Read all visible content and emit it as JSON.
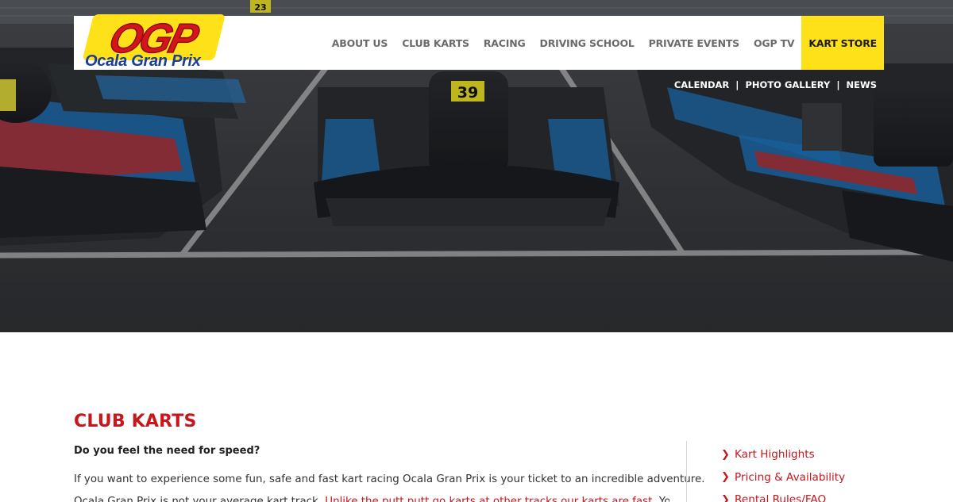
{
  "brand": {
    "logo_mark": "OGP",
    "tagline": "Ocala Gran Prix"
  },
  "nav": {
    "items": [
      {
        "label": "ABOUT US"
      },
      {
        "label": "CLUB KARTS"
      },
      {
        "label": "RACING"
      },
      {
        "label": "DRIVING SCHOOL"
      },
      {
        "label": "PRIVATE EVENTS"
      },
      {
        "label": "OGP TV"
      }
    ],
    "store_label": "KART STORE"
  },
  "subnav": {
    "items": [
      "CALENDAR",
      "PHOTO GALLERY",
      "NEWS"
    ],
    "separator": "|"
  },
  "hero": {
    "kart_numbers": [
      "39",
      "23"
    ]
  },
  "content": {
    "title": "CLUB KARTS",
    "lead": "Do you feel the need for speed?",
    "paragraph1": "If you want to experience some fun, safe and fast kart racing Ocala Gran Prix is your ticket to an incredible adventure.",
    "paragraph2_start": "Ocala Gran Prix is not your average kart track. ",
    "paragraph2_link": "Unlike the putt putt go karts at other tracks our karts are fast.",
    "paragraph2_end": " You will feel"
  },
  "sidebar": {
    "links": [
      "Kart Highlights",
      "Pricing & Availability",
      "Rental Rules/FAQ"
    ]
  },
  "colors": {
    "accent_red": "#c8161d",
    "store_yellow": "#ffe11a",
    "logo_blue": "#1a3d99"
  }
}
